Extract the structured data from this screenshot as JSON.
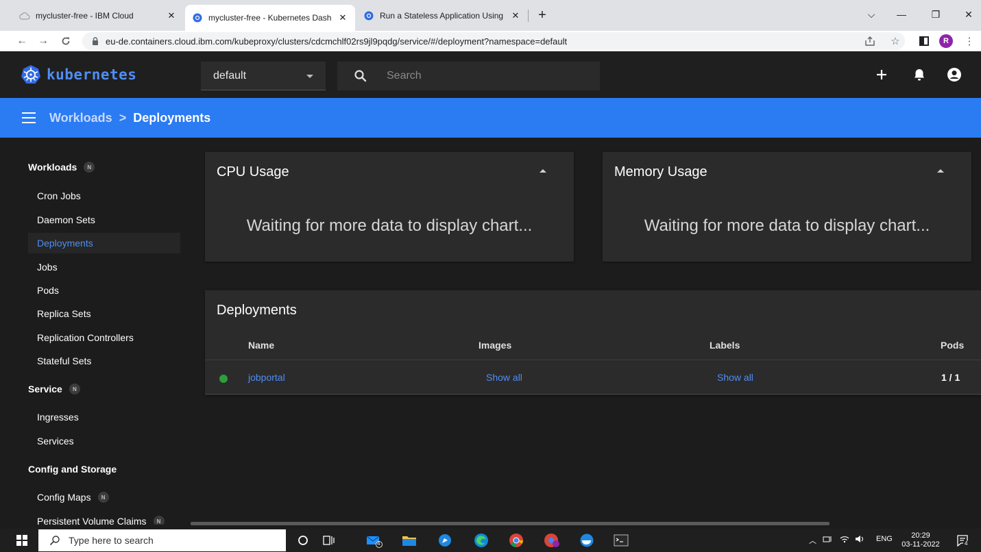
{
  "browser": {
    "tabs": [
      {
        "title": "mycluster-free - IBM Cloud",
        "active": false
      },
      {
        "title": "mycluster-free - Kubernetes Dash",
        "active": true
      },
      {
        "title": "Run a Stateless Application Using",
        "active": false
      }
    ],
    "url": "eu-de.containers.cloud.ibm.com/kubeproxy/clusters/cdcmchlf02rs9jl9pqdg/service/#/deployment?namespace=default",
    "profile_initial": "R"
  },
  "header": {
    "brand": "kubernetes",
    "namespace": "default",
    "search_placeholder": "Search"
  },
  "breadcrumb": {
    "parent": "Workloads",
    "separator": ">",
    "current": "Deployments"
  },
  "sidebar": {
    "badge": "N",
    "sections": [
      {
        "label": "Workloads",
        "items": [
          "Cron Jobs",
          "Daemon Sets",
          "Deployments",
          "Jobs",
          "Pods",
          "Replica Sets",
          "Replication Controllers",
          "Stateful Sets"
        ]
      },
      {
        "label": "Service",
        "items": [
          "Ingresses",
          "Services"
        ]
      },
      {
        "label": "Config and Storage",
        "items": [
          "Config Maps",
          "Persistent Volume Claims"
        ]
      }
    ],
    "active_item": "Deployments"
  },
  "cards": {
    "cpu": {
      "title": "CPU Usage",
      "message": "Waiting for more data to display chart..."
    },
    "memory": {
      "title": "Memory Usage",
      "message": "Waiting for more data to display chart..."
    }
  },
  "deployments": {
    "title": "Deployments",
    "columns": [
      "Name",
      "Images",
      "Labels",
      "Pods"
    ],
    "rows": [
      {
        "name": "jobportal",
        "images": "Show all",
        "labels": "Show all",
        "pods": "1 / 1",
        "status": "running"
      }
    ]
  },
  "taskbar": {
    "search_placeholder": "Type here to search",
    "mail_badge": "4",
    "notif_badge": "4",
    "language": "ENG",
    "time": "20:29",
    "date": "03-11-2022"
  },
  "colors": {
    "accent": "#2b7bf3",
    "link": "#4f8ef5",
    "status_ok": "#2e9e3c"
  }
}
